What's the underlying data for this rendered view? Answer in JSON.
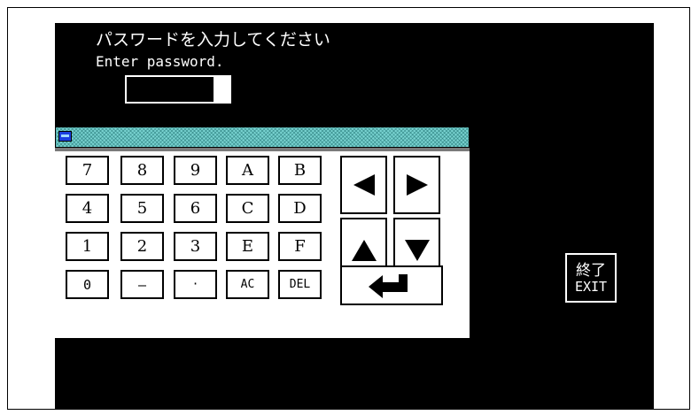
{
  "prompt": {
    "japanese": "パスワードを入力してください",
    "english": "Enter password."
  },
  "password_field": {
    "value": ""
  },
  "keypad": {
    "rows": [
      [
        "7",
        "8",
        "9",
        "A",
        "B"
      ],
      [
        "4",
        "5",
        "6",
        "C",
        "D"
      ],
      [
        "1",
        "2",
        "3",
        "E",
        "F"
      ],
      [
        "0",
        "—",
        "·",
        "AC",
        "DEL"
      ]
    ],
    "icons": {
      "left": "arrow-left-icon",
      "right": "arrow-right-icon",
      "up": "arrow-up-icon",
      "down": "arrow-down-icon",
      "enter": "enter-icon"
    },
    "titlebar_color": "#79d3d1",
    "system_icon": "window-menu-icon"
  },
  "exit_button": {
    "label_jp": "終了",
    "label_en": "EXIT"
  },
  "colors": {
    "screen_bg": "#000000",
    "text": "#ffffff",
    "key_bg": "#ffffff"
  }
}
